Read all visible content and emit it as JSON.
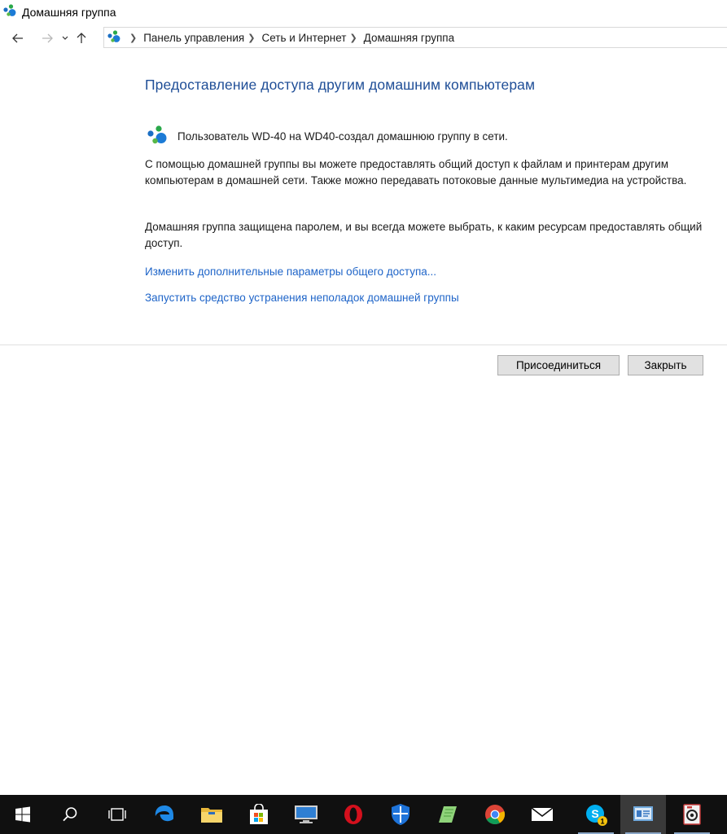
{
  "window": {
    "title": "Домашняя группа"
  },
  "navigation": {
    "breadcrumbs": [
      "Панель управления",
      "Сеть и Интернет",
      "Домашняя группа"
    ]
  },
  "content": {
    "heading": "Предоставление доступа другим домашним компьютерам",
    "owner_text": "Пользователь WD-40  на WD40-создал домашнюю группу в сети.",
    "paragraph1": "С помощью домашней группы вы можете предоставлять общий доступ к файлам и принтерам другим компьютерам в домашней сети. Также можно передавать потоковые данные мультимедиа на устройства.",
    "paragraph2": "Домашняя группа защищена паролем, и вы всегда можете выбрать, к каким ресурсам предоставлять общий доступ.",
    "link_sharing": "Изменить дополнительные параметры общего доступа...",
    "link_troubleshoot": "Запустить средство устранения неполадок домашней группы"
  },
  "buttons": {
    "join": "Присоединиться",
    "close": "Закрыть"
  },
  "taskbar": {
    "items": [
      "start-icon",
      "search-icon",
      "task-view-icon",
      "edge-icon",
      "file-explorer-icon",
      "store-icon",
      "remote-desktop-icon",
      "opera-icon",
      "defender-icon",
      "notes-icon",
      "chrome-icon",
      "mail-icon",
      "skype-icon",
      "control-panel-icon",
      "camera-app-icon"
    ],
    "skype_badge": "1"
  },
  "colors": {
    "heading": "#1f4e97",
    "link": "#1e64c8",
    "taskbar": "#101010"
  }
}
